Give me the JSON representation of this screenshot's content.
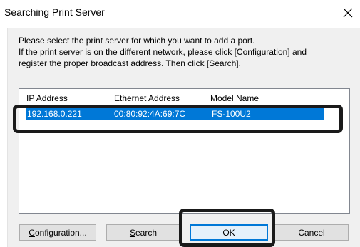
{
  "window": {
    "title": "Searching Print Server"
  },
  "instructions": {
    "line1": "Please select the print server for which you want to add a port.",
    "line2": "If the print server is on the different network, please click [Configuration] and",
    "line3": "register the proper broadcast address. Then click [Search]."
  },
  "list": {
    "columns": [
      "IP Address",
      "Ethernet Address",
      "Model Name"
    ],
    "rows": [
      {
        "ip": "192.168.0.221",
        "mac": "00:80:92:4A:69:7C",
        "model": "FS-100U2",
        "selected": true
      }
    ]
  },
  "buttons": {
    "configuration": {
      "accel": "C",
      "rest": "onfiguration..."
    },
    "search": {
      "accel": "S",
      "rest": "earch"
    },
    "ok": "OK",
    "cancel": "Cancel"
  },
  "colors": {
    "selection": "#0078d7",
    "highlight_outline": "#1a1a1a"
  },
  "icons": {
    "close": "close-icon"
  }
}
